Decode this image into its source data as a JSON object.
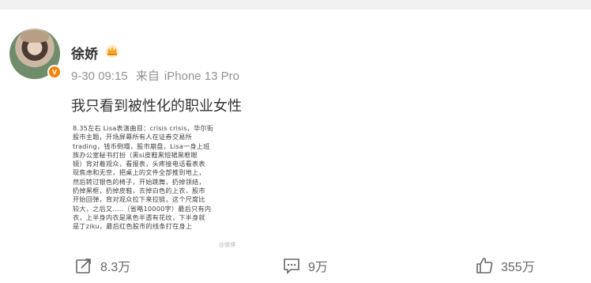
{
  "post": {
    "author": "徐娇",
    "date": "9-30 09:15",
    "source_prefix": "来自",
    "device": "iPhone 13 Pro",
    "text": "我只看到被性化的职业女性",
    "image_lines": [
      "8.35左右 Lisa表演曲目：crisis crisis，华尔街",
      "股市主题，开场屏幕所有人在证券交易所",
      "trading，钱币倒塌，股市崩盘，Lisa一身上班",
      "族办公室秘书打扮（黑si皮鞋黑短裙黑框眼",
      "镜）背对着观众，看报表，头疼接电话看表表",
      "现焦虑和无奈，把桌上的文件全部推到地上，",
      "然后转过银色的椅子，开始跳舞，扔掉领结，",
      "扔掉黑框，扔掉皮鞋，去掉白色的上衣，股市",
      "开始回弹，背对观众拉下来拉链，这个尺度比",
      "较大，之后又…..（省略10000字）最后只有内",
      "衣，上半身内衣是黑色半透有花纹，下半身就",
      "是丁ziku，最后红色股市的线条打在身上"
    ],
    "image_watermark": "@微博"
  },
  "actions": {
    "repost_count": "8.3万",
    "comment_count": "9万",
    "like_count": "355万"
  },
  "colors": {
    "badge": "#f58300",
    "meta": "#939393"
  }
}
